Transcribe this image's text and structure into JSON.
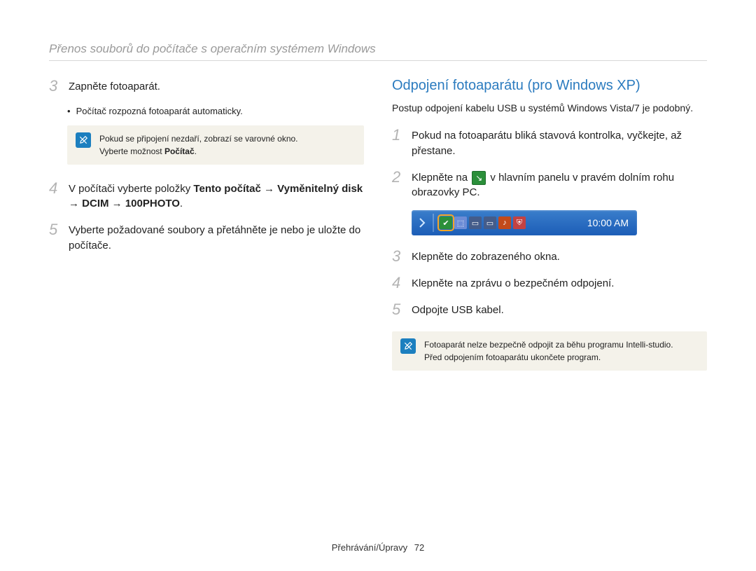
{
  "header": {
    "title": "Přenos souborů do počítače s operačním systémem Windows"
  },
  "left": {
    "step3": {
      "num": "3",
      "text": "Zapněte fotoaparát."
    },
    "step3_sub": "Počítač rozpozná fotoaparát automaticky.",
    "note": {
      "line1": "Pokud se připojení nezdaří, zobrazí se varovné okno.",
      "line2_prefix": "Vyberte možnost ",
      "line2_bold": "Počítač",
      "line2_suffix": "."
    },
    "step4": {
      "num": "4",
      "prefix": "V počítači vyberte položky ",
      "bold": "Tento počítač → Vyměnitelný disk → DCIM → 100PHOTO",
      "suffix": "."
    },
    "step5": {
      "num": "5",
      "text": "Vyberte požadované soubory a přetáhněte je nebo je uložte do počítače."
    }
  },
  "right": {
    "heading": "Odpojení fotoaparátu (pro Windows XP)",
    "intro": "Postup odpojení kabelu USB u systémů Windows Vista/7 je podobný.",
    "step1": {
      "num": "1",
      "text": "Pokud na fotoaparátu bliká stavová kontrolka, vyčkejte, až přestane."
    },
    "step2": {
      "num": "2",
      "pre": "Klepněte na ",
      "post": " v hlavním panelu v pravém dolním rohu obrazovky PC."
    },
    "taskbar_clock": "10:00 AM",
    "step3": {
      "num": "3",
      "text": "Klepněte do zobrazeného okna."
    },
    "step4": {
      "num": "4",
      "text": "Klepněte na zprávu o bezpečném odpojení."
    },
    "step5": {
      "num": "5",
      "text": "Odpojte USB kabel."
    },
    "note": {
      "line1": "Fotoaparát nelze bezpečně odpojit za běhu programu Intelli-studio.",
      "line2": "Před odpojením fotoaparátu ukončete program."
    }
  },
  "footer": {
    "section": "Přehrávání/Úpravy",
    "page": "72"
  }
}
